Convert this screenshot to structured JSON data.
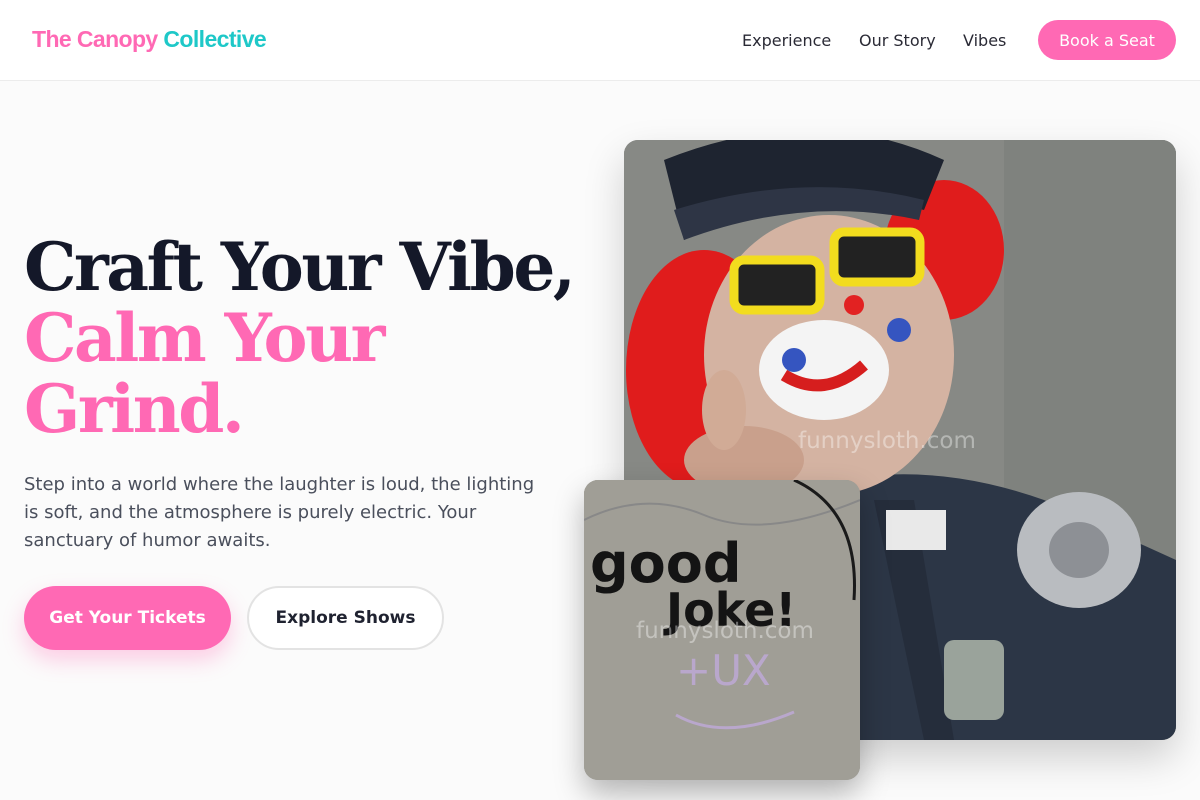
{
  "brand": {
    "part1": "The Canopy",
    "part2": "Collective",
    "colors": {
      "pink": "#ff69b4",
      "teal": "#1ec8c8"
    }
  },
  "nav": {
    "links": [
      "Experience",
      "Our Story",
      "Vibes"
    ],
    "cta": "Book a Seat"
  },
  "hero": {
    "line1": "Craft Your Vibe,",
    "line2": "Calm Your",
    "line3": "Grind.",
    "description": "Step into a world where the laughter is loud, the lighting is soft, and the atmosphere is purely electric. Your sanctuary of humor awaits.",
    "primary_cta": "Get Your Tickets",
    "secondary_cta": "Explore Shows"
  },
  "images": {
    "main": {
      "watermark": "funnysloth.com"
    },
    "secondary": {
      "graffiti_line1": "good",
      "graffiti_line2": "Joke!",
      "graffiti_scrawl": "+UX",
      "watermark": "funnysloth.com"
    }
  }
}
